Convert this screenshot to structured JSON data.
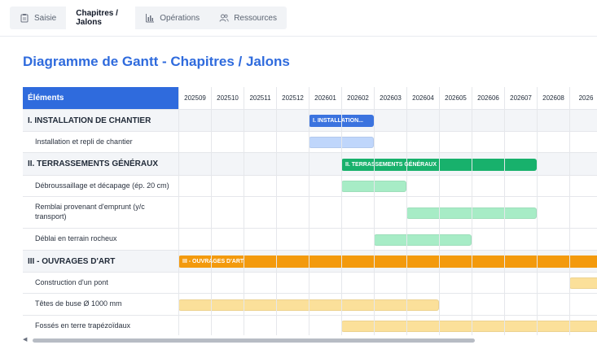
{
  "tabs": [
    {
      "label": "Saisie",
      "icon": "clipboard-icon",
      "active": false
    },
    {
      "label": "Chapitres / Jalons",
      "icon": "",
      "active": true
    },
    {
      "label": "Opérations",
      "icon": "bar-chart-icon",
      "active": false
    },
    {
      "label": "Ressources",
      "icon": "users-icon",
      "active": false
    }
  ],
  "page_title": "Diagramme de Gantt - Chapitres / Jalons",
  "gantt": {
    "elements_header": "Éléments",
    "months": [
      "202509",
      "202510",
      "202511",
      "202512",
      "202601",
      "202602",
      "202603",
      "202604",
      "202605",
      "202606",
      "202607",
      "202608",
      "2026"
    ],
    "rows": [
      {
        "label": "I. INSTALLATION DE CHANTIER",
        "type": "chapter",
        "bar": {
          "text": "I. INSTALLATION...",
          "start": 4,
          "end": 6,
          "color": "#3b73df"
        }
      },
      {
        "label": "Installation et repli de chantier",
        "type": "task",
        "bar": {
          "text": "",
          "start": 4,
          "end": 6,
          "color": "#bfd6fb"
        }
      },
      {
        "label": "II. TERRASSEMENTS GÉNÉRAUX",
        "type": "chapter",
        "bar": {
          "text": "II. TERRASSEMENTS GÉNÉRAUX",
          "start": 5,
          "end": 11,
          "color": "#18b16c"
        }
      },
      {
        "label": "Débroussaillage et décapage (ép. 20 cm)",
        "type": "task",
        "bar": {
          "text": "",
          "start": 5,
          "end": 7,
          "color": "#a7ecc6"
        }
      },
      {
        "label": "Remblai provenant d'emprunt (y/c transport)",
        "type": "task",
        "bar": {
          "text": "",
          "start": 7,
          "end": 11,
          "color": "#a7ecc6"
        }
      },
      {
        "label": "Déblai en terrain rocheux",
        "type": "task",
        "bar": {
          "text": "",
          "start": 6,
          "end": 9,
          "color": "#a7ecc6"
        }
      },
      {
        "label": "III - OUVRAGES D'ART",
        "type": "chapter",
        "bar": {
          "text": "III - OUVRAGES D'ART",
          "start": 0,
          "end": 13,
          "color": "#f39a0d"
        }
      },
      {
        "label": "Construction d'un pont",
        "type": "task",
        "bar": {
          "text": "",
          "start": 12,
          "end": 13,
          "color": "#fbe09a"
        }
      },
      {
        "label": "Têtes de buse Ø 1000 mm",
        "type": "task",
        "bar": {
          "text": "",
          "start": 0,
          "end": 8,
          "color": "#fbe09a"
        }
      },
      {
        "label": "Fossés en terre trapézoïdaux",
        "type": "task",
        "bar": {
          "text": "",
          "start": 5,
          "end": 13,
          "color": "#fbe09a"
        }
      }
    ]
  },
  "scrollbar": {
    "arrow": "◀"
  }
}
